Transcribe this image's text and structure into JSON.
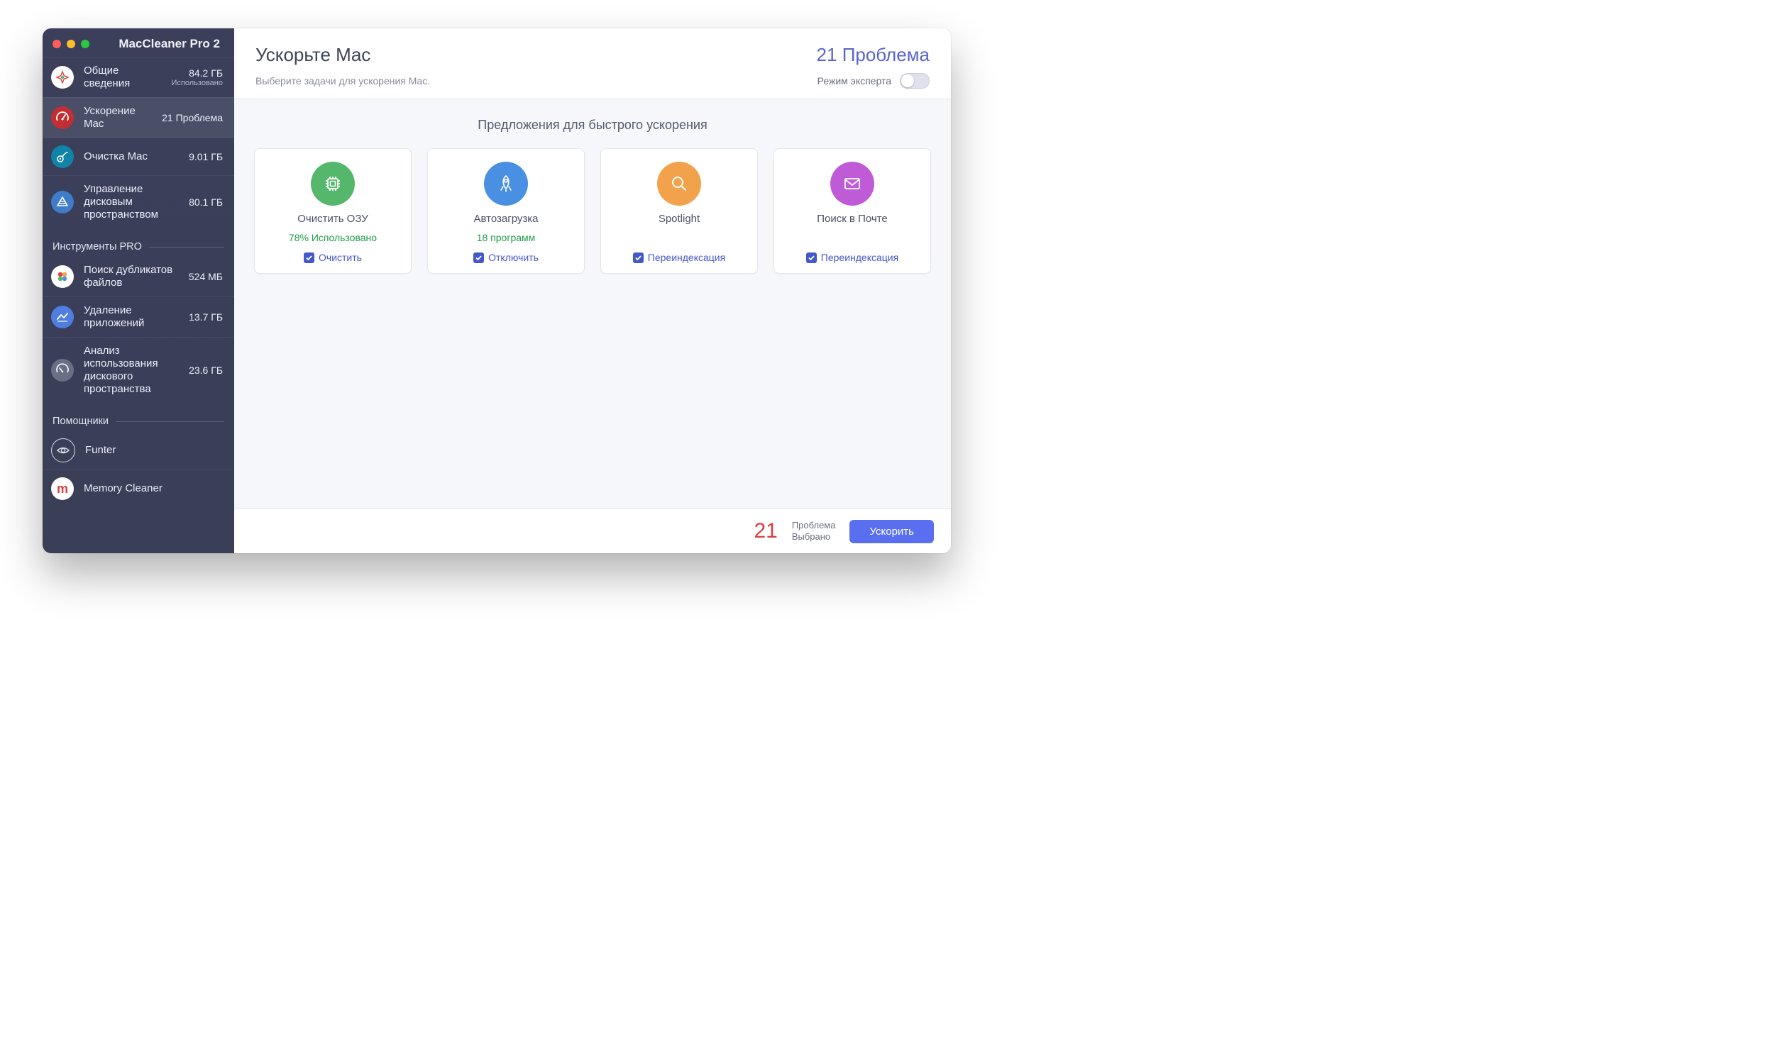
{
  "app_title": "MacCleaner Pro 2",
  "sidebar": {
    "main": [
      {
        "label": "Общие сведения",
        "value": "84.2 ГБ",
        "subvalue": "Использовано"
      },
      {
        "label": "Ускорение Mac",
        "value": "21 Проблема"
      },
      {
        "label": "Очистка Mac",
        "value": "9.01 ГБ"
      },
      {
        "label": "Управление дисковым пространством",
        "value": "80.1 ГБ"
      }
    ],
    "section_pro": "Инструменты PRO",
    "pro": [
      {
        "label": "Поиск дубликатов файлов",
        "value": "524 МБ"
      },
      {
        "label": "Удаление приложений",
        "value": "13.7 ГБ"
      },
      {
        "label": "Анализ использования дискового пространства",
        "value": "23.6 ГБ"
      }
    ],
    "section_helpers": "Помощники",
    "helpers": [
      {
        "label": "Funter"
      },
      {
        "label": "Memory Cleaner"
      }
    ]
  },
  "header": {
    "title": "Ускорьте Mac",
    "issues": "21 Проблема",
    "subtitle": "Выберите задачи для ускорения Mac.",
    "expert_mode": "Режим эксперта"
  },
  "content": {
    "suggestions_title": "Предложения для быстрого ускорения",
    "cards": [
      {
        "title": "Очистить ОЗУ",
        "status": "78% Использовано",
        "action": "Очистить"
      },
      {
        "title": "Автозагрузка",
        "status": "18 программ",
        "action": "Отключить"
      },
      {
        "title": "Spotlight",
        "status": "",
        "action": "Переиндексация"
      },
      {
        "title": "Поиск в Почте",
        "status": "",
        "action": "Переиндексация"
      }
    ]
  },
  "footer": {
    "count": "21",
    "line1": "Проблема",
    "line2": "Выбрано",
    "button": "Ускорить"
  }
}
